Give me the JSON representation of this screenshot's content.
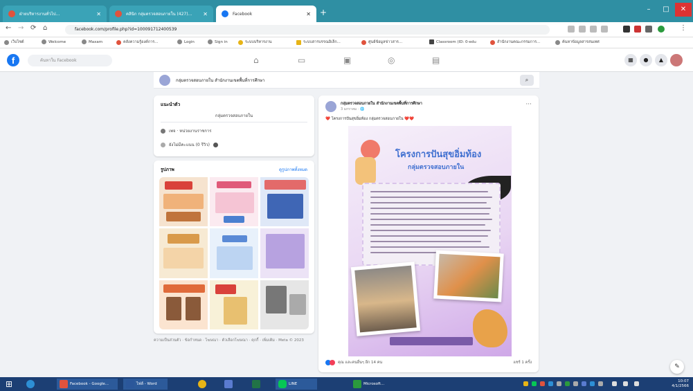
{
  "browser": {
    "tabs": [
      {
        "label": "ฝ่ายบริหารงานทั่วไป...",
        "color": "#e0533d",
        "active": false
      },
      {
        "label": "คลินิก กลุ่มตรวจสอบภายใน (427)...",
        "color": "#e0533d",
        "active": false
      },
      {
        "label": "Facebook",
        "color": "#1877f2",
        "active": true
      }
    ],
    "new_tab": "+",
    "window": {
      "minimize": "–",
      "maximize": "□",
      "close": "✕"
    },
    "nav": {
      "back": "←",
      "forward": "→",
      "reload": "⟳",
      "home": "⌂"
    },
    "url": "facebook.com/profile.php?id=100091712400539",
    "bookmarks": [
      {
        "label": "เว็บไซต์",
        "color": "#888"
      },
      {
        "label": "Welcome",
        "color": "#888"
      },
      {
        "label": "Maxam",
        "color": "#888"
      },
      {
        "label": "คลังความรู้องค์การ...",
        "color": "#e0533d"
      },
      {
        "label": "Login",
        "color": "#888"
      },
      {
        "label": "Sign in",
        "color": "#888"
      },
      {
        "label": "ระบบบริหารงาน",
        "color": "#e7b416"
      },
      {
        "label": "ระบบสารบรรณอิเล็ก...",
        "color": "#e7b416"
      },
      {
        "label": "ศูนย์ข้อมูลข่าวสาร...",
        "color": "#e0533d"
      },
      {
        "label": "Classroom (ID: 0-edu",
        "color": "#444"
      },
      {
        "label": "สำนักงานคณะกรรมการ...",
        "color": "#e0533d"
      },
      {
        "label": "ค้นหาข้อมูลสารสนเทศ",
        "color": "#888"
      }
    ]
  },
  "facebook": {
    "logo": "f",
    "search_placeholder": "ค้นหาใน Facebook",
    "page_name": "กลุ่มตรวจสอบภายใน สำนักงานเขตพื้นที่การศึกษา",
    "intro": {
      "title": "แนะนำตัว",
      "bio": "กลุ่มตรวจสอบภายใน",
      "category": "เพจ · หน่วยงานราชการ",
      "rating": "ยังไม่มีคะแนน (0 รีวิว)"
    },
    "photos": {
      "title": "รูปภาพ",
      "see_all": "ดูรูปภาพทั้งหมด"
    },
    "footer": "ความเป็นส่วนตัว · ข้อกำหนด · โฆษณา · ตัวเลือกโฆษณา · คุกกี้ · เพิ่มเติม · Meta © 2023",
    "post": {
      "author": "กลุ่มตรวจสอบภายใน สำนักงานเขตพื้นที่การศึกษา",
      "time": "3 มกราคม · 🌐",
      "caption": "❤️ โครงการปันสุขอิ่มท้อง กลุ่มตรวจสอบภายใน ❤️❤️",
      "poster_title": "โครงการปันสุขอิ่มท้อง",
      "poster_subtitle": "กลุ่มตรวจสอบภายใน",
      "reactions": "คุณ และคนอื่นๆ อีก 14 คน",
      "shares": "แชร์ 1 ครั้ง"
    },
    "header_icons": [
      "home-icon",
      "video-icon",
      "marketplace-icon",
      "groups-icon",
      "gaming-icon"
    ]
  },
  "taskbar": {
    "start": "⊞",
    "apps": [
      {
        "label": "",
        "color": "#2d8fd5"
      },
      {
        "label": "Facebook - Google...",
        "color": "#e0533d"
      },
      {
        "label": "ไฟล์ - Word",
        "color": "#2b579a"
      },
      {
        "label": "",
        "color": "#e7b416"
      },
      {
        "label": "",
        "color": "#5a7bd0"
      },
      {
        "label": "",
        "color": "#217346"
      },
      {
        "label": "LINE",
        "color": "#06c755"
      },
      {
        "label": "Microsoft...",
        "color": "#2b9a3d"
      }
    ],
    "time": "10:07",
    "date": "4/1/2566"
  }
}
